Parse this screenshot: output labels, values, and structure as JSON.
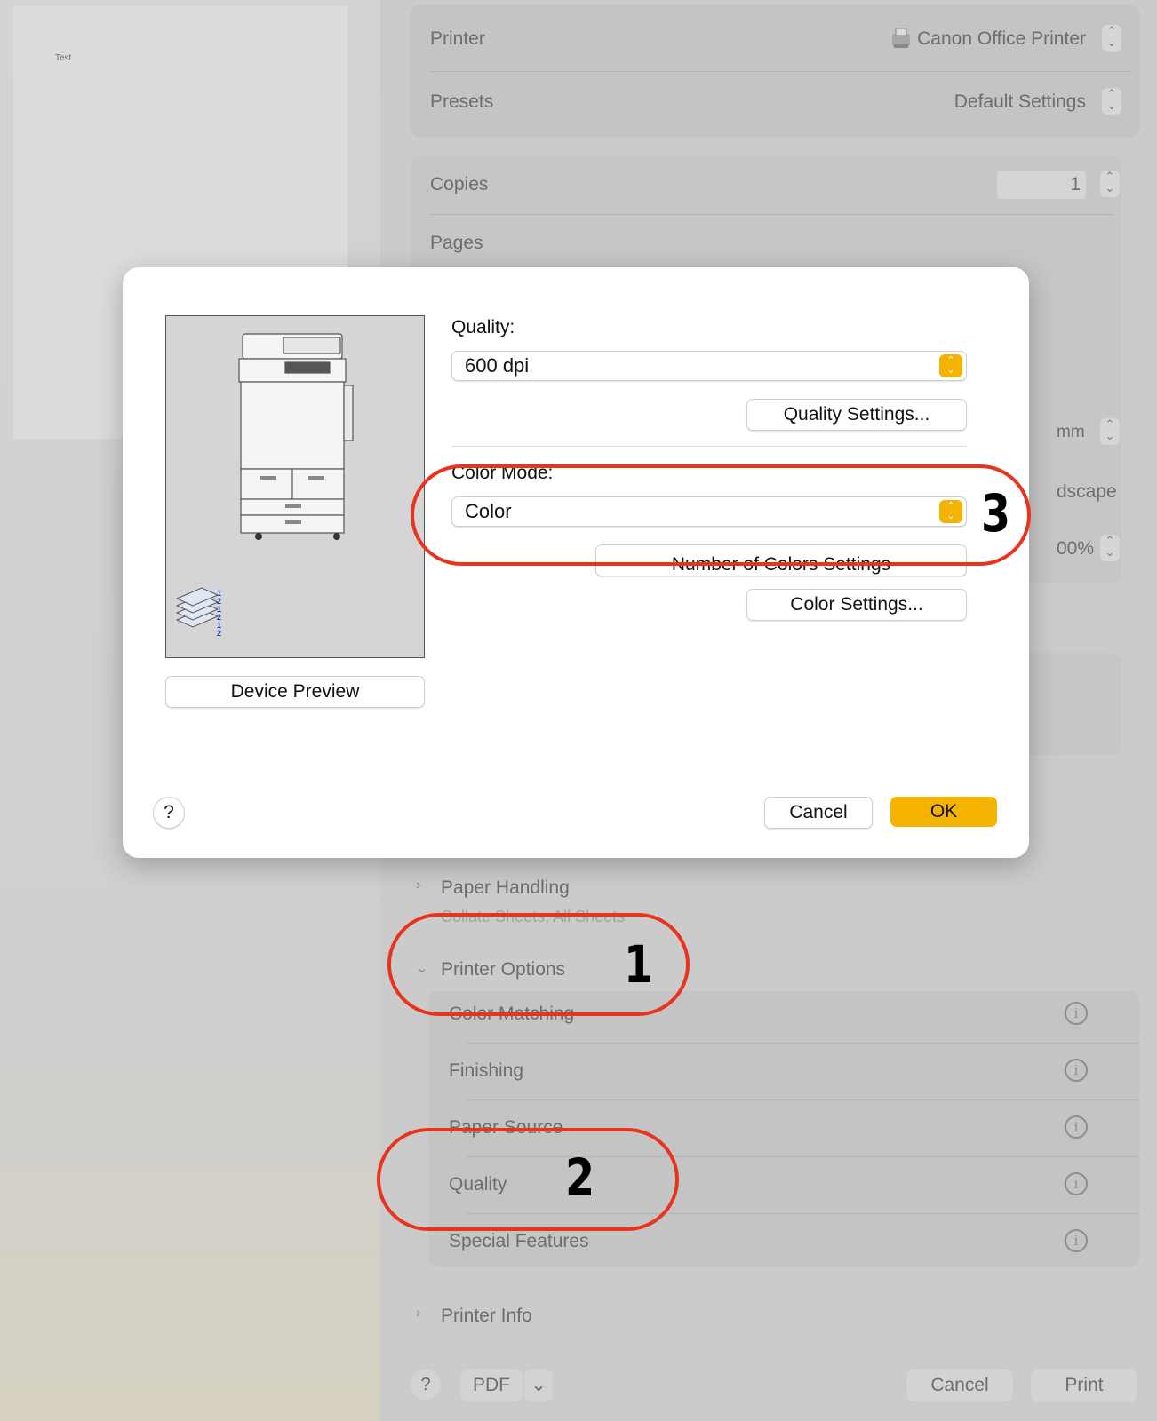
{
  "preview": {
    "page_text": "Test"
  },
  "print_panel": {
    "printer_label": "Printer",
    "printer_value": "Canon Office Printer",
    "presets_label": "Presets",
    "presets_value": "Default Settings",
    "copies_label": "Copies",
    "copies_value": "1",
    "pages_label": "Pages",
    "paper_size_unit": "mm",
    "orientation_partial": "dscape",
    "scale_partial": "00%",
    "paper_handling": {
      "title": "Paper Handling",
      "summary": "Collate Sheets, All Sheets"
    },
    "printer_options": {
      "title": "Printer Options",
      "items": [
        {
          "label": "Color Matching"
        },
        {
          "label": "Finishing"
        },
        {
          "label": "Paper Source"
        },
        {
          "label": "Quality"
        },
        {
          "label": "Special Features"
        }
      ]
    },
    "printer_info": {
      "title": "Printer Info"
    },
    "bottom": {
      "help": "?",
      "pdf": "PDF",
      "cancel": "Cancel",
      "print": "Print"
    }
  },
  "dialog": {
    "quality_label": "Quality:",
    "quality_value": "600 dpi",
    "quality_settings_button": "Quality Settings...",
    "color_mode_label": "Color Mode:",
    "color_mode_value": "Color",
    "number_of_colors_button": "Number of Colors Settings",
    "color_settings_button": "Color Settings...",
    "device_preview_button": "Device Preview",
    "help": "?",
    "cancel": "Cancel",
    "ok": "OK",
    "collate_digits": "1\n2\n1\n2\n1\n2"
  },
  "annotations": {
    "one": "1",
    "two": "2",
    "three": "3"
  },
  "colors": {
    "accent": "#f3b300",
    "annotation": "#e8341f"
  }
}
